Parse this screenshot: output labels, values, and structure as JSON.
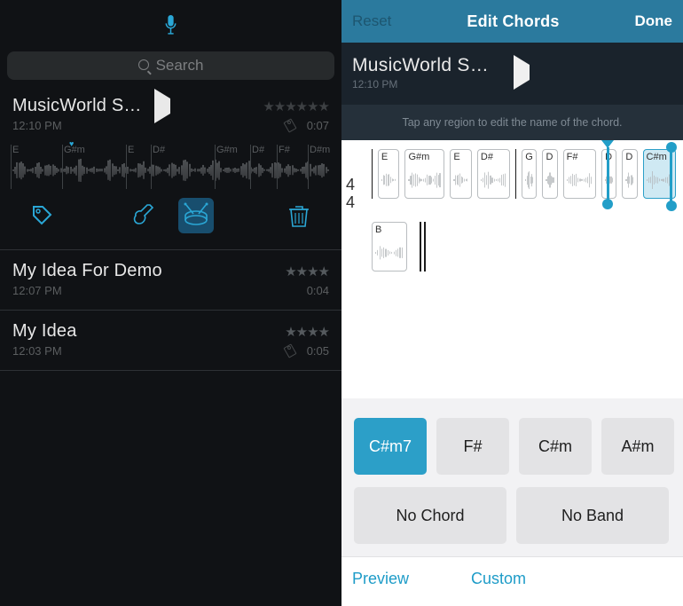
{
  "left": {
    "search_placeholder": "Search",
    "selected": {
      "title": "MusicWorld S…",
      "time": "12:10 PM",
      "stars": "★★★★★★",
      "duration": "0:07",
      "chords": [
        "E",
        "G#m",
        "E",
        "D#",
        "G#m",
        "D#",
        "F#",
        "D#m"
      ]
    },
    "items": [
      {
        "title": "My Idea For Demo",
        "time": "12:07 PM",
        "stars": "★★★★",
        "duration": "0:04"
      },
      {
        "title": "My Idea",
        "time": "12:03 PM",
        "stars": "★★★★",
        "duration": "0:05"
      }
    ],
    "icons": {
      "tag": "tag",
      "guitar": "guitar",
      "drums": "drums",
      "trash": "trash"
    }
  },
  "right": {
    "reset": "Reset",
    "header": "Edit Chords",
    "done": "Done",
    "now": {
      "title": "MusicWorld S…",
      "time": "12:10 PM"
    },
    "hint": "Tap any region to edit the name of the chord.",
    "time_sig_top": "4",
    "time_sig_bot": "4",
    "regions": [
      "E",
      "G#m",
      "E",
      "D#",
      "G",
      "D",
      "F#",
      "D",
      "D",
      "C#m"
    ],
    "region2": [
      "B"
    ],
    "choices": [
      "C#m7",
      "F#",
      "C#m",
      "A#m"
    ],
    "wide_choices": [
      "No Chord",
      "No Band"
    ],
    "preview": "Preview",
    "custom": "Custom",
    "selected_choices": [
      "C#m7"
    ]
  },
  "colors": {
    "accent": "#2aa7d6",
    "teal": "#2b7a9e"
  }
}
